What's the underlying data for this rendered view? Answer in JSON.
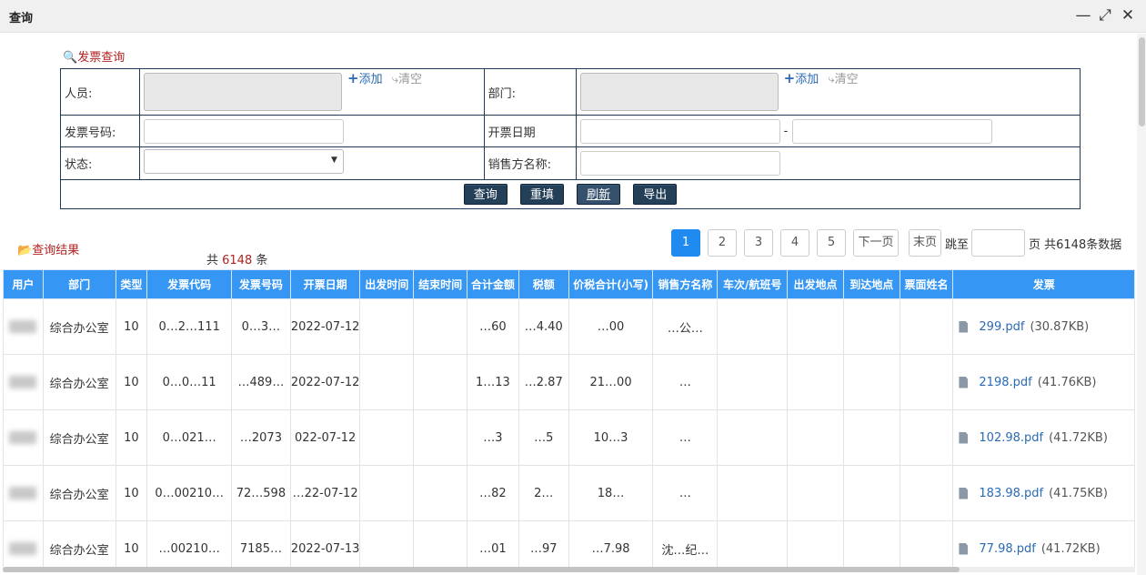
{
  "window": {
    "title": "查询"
  },
  "search": {
    "heading": "发票查询",
    "labels": {
      "person": "人员:",
      "dept": "部门:",
      "invoice_no": "发票号码:",
      "issue_date": "开票日期",
      "status": "状态:",
      "seller": "销售方名称:"
    },
    "add_label": "添加",
    "clear_label": "清空",
    "date_separator": "-",
    "buttons": {
      "query": "查询",
      "reset": "重填",
      "refresh": "刷新",
      "export": "导出"
    }
  },
  "results": {
    "heading": "查询结果",
    "count_prefix": "共 ",
    "count": "6148",
    "count_suffix": " 条",
    "pager": {
      "pages": [
        "1",
        "2",
        "3",
        "4",
        "5"
      ],
      "current": "1",
      "next": "下一页",
      "last": "末页",
      "jump_label": "跳至",
      "summary": "页 共6148条数据"
    },
    "columns": [
      "用户",
      "部门",
      "类型",
      "发票代码",
      "发票号码",
      "开票日期",
      "出发时间",
      "结束时间",
      "合计金额",
      "税额",
      "价税合计(小写)",
      "销售方名称",
      "车次/航班号",
      "出发地点",
      "到达地点",
      "票面姓名",
      "发票"
    ],
    "rows": [
      {
        "dept": "综合办公室",
        "type": "10",
        "code": "0…2…111",
        "number": "0…3…",
        "date": "2022-07-12",
        "amount": "…60",
        "tax": "…4.40",
        "total": "…00",
        "seller": "…公…",
        "file": "299.pdf",
        "size": "(30.87KB)"
      },
      {
        "dept": "综合办公室",
        "type": "10",
        "code": "0…0…11",
        "number": "…489…",
        "date": "2022-07-12",
        "amount": "1…13",
        "tax": "…2.87",
        "total": "21…00",
        "seller": "…",
        "file": "2198.pdf",
        "size": "(41.76KB)"
      },
      {
        "dept": "综合办公室",
        "type": "10",
        "code": "0…021…",
        "number": "…2073",
        "date": "022-07-12",
        "amount": "…3",
        "tax": "…5",
        "total": "10…3",
        "seller": "…",
        "file": "102.98.pdf",
        "size": "(41.72KB)"
      },
      {
        "dept": "综合办公室",
        "type": "10",
        "code": "0…00210…",
        "number": "72…598",
        "date": "…22-07-12",
        "amount": "…82",
        "tax": "2…",
        "total": "18…",
        "seller": "…",
        "file": "183.98.pdf",
        "size": "(41.75KB)"
      },
      {
        "dept": "综合办公室",
        "type": "10",
        "code": "…00210…",
        "number": "7185…",
        "date": "2022-07-13",
        "amount": "…01",
        "tax": "…97",
        "total": "…7.98",
        "seller": "沈…纪…",
        "file": "77.98.pdf",
        "size": "(41.72KB)"
      }
    ]
  },
  "colors": {
    "header_blue": "#3596f3",
    "button_dark": "#243f58",
    "accent_red": "#b22222",
    "link_blue": "#2a6ab5"
  }
}
